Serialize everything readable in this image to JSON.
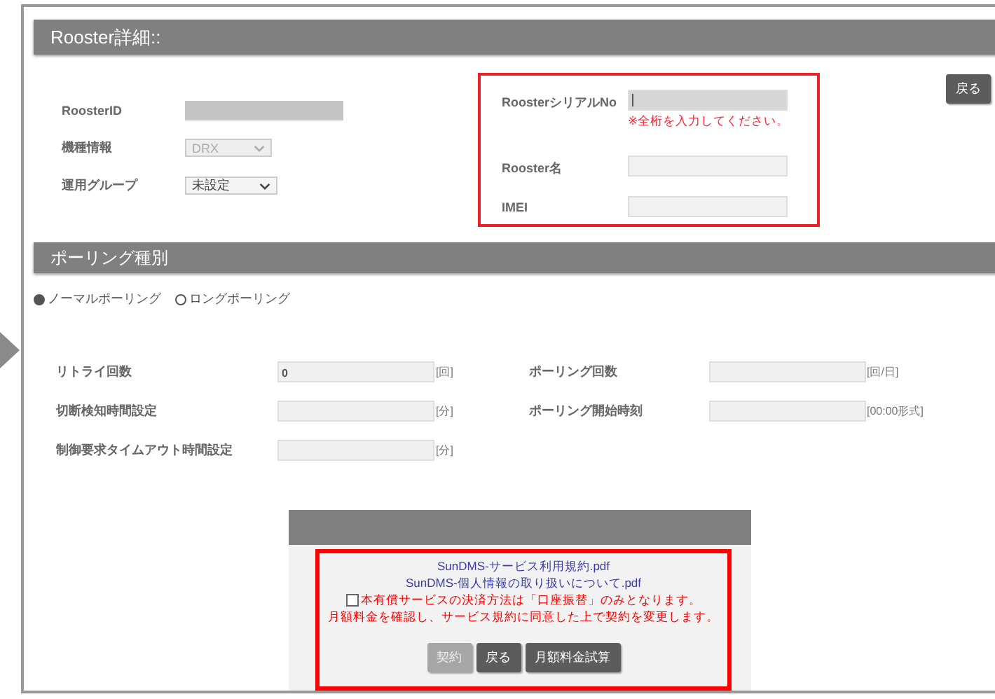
{
  "detail": {
    "title": "Rooster詳細::",
    "back_button": "戻る",
    "fields": [
      {
        "label": "RoosterID",
        "kind": "readonly"
      },
      {
        "label": "機種情報",
        "kind": "select",
        "value": "DRX",
        "disabled": true
      },
      {
        "label": "運用グループ",
        "kind": "select",
        "value": "未設定",
        "disabled": false
      }
    ],
    "device_fields": [
      {
        "label": "RoosterシリアルNo",
        "focused": true,
        "note": "※全桁を入力してください。"
      },
      {
        "label": "Rooster名",
        "focused": false
      },
      {
        "label": "IMEI",
        "focused": false
      }
    ]
  },
  "polling": {
    "title": "ポーリング種別",
    "options": [
      {
        "label": "ノーマルポーリング",
        "selected": true
      },
      {
        "label": "ロングポーリング",
        "selected": false
      }
    ],
    "left_settings": [
      {
        "label": "リトライ回数",
        "value": "0",
        "unit": "[回]"
      },
      {
        "label": "切断検知時間設定",
        "unit": "[分]"
      },
      {
        "label": "制御要求タイムアウト時間設定",
        "unit": "[分]"
      }
    ],
    "right_settings": [
      {
        "label": "ポーリング回数",
        "unit": "[回/日]"
      },
      {
        "label": "ポーリング開始時刻",
        "unit": "[00:00形式]"
      }
    ]
  },
  "contract": {
    "links": [
      "SunDMS-サービス利用規約.pdf",
      "SunDMS-個人情報の取り扱いについて.pdf"
    ],
    "agree": {
      "checked": false,
      "label": "本有償サービスの決済方法は「口座振替」のみとなります。"
    },
    "notice": "月額料金を確認し、サービス規約に同意した上で契約を変更します。",
    "buttons": [
      {
        "label": "契約",
        "disabled": true
      },
      {
        "label": "戻る",
        "disabled": false
      },
      {
        "label": "月額料金試算",
        "disabled": false
      }
    ]
  }
}
